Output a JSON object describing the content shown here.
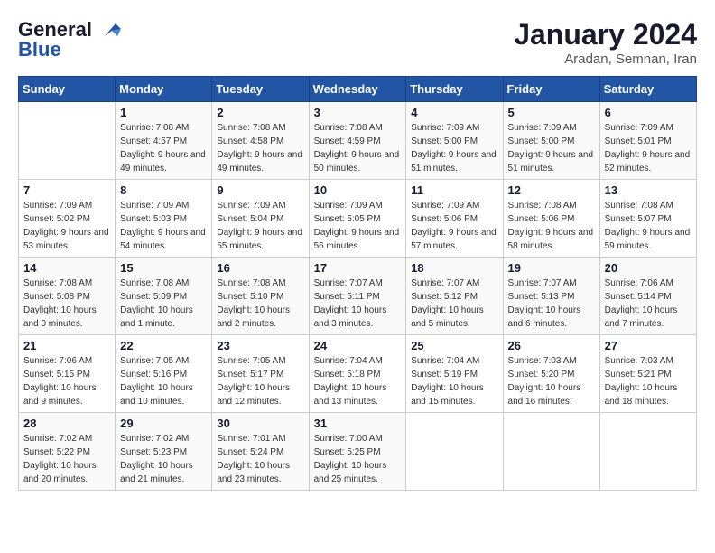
{
  "logo": {
    "line1": "General",
    "line2": "Blue"
  },
  "calendar": {
    "title": "January 2024",
    "subtitle": "Aradan, Semnan, Iran"
  },
  "headers": [
    "Sunday",
    "Monday",
    "Tuesday",
    "Wednesday",
    "Thursday",
    "Friday",
    "Saturday"
  ],
  "weeks": [
    [
      {
        "day": "",
        "sunrise": "",
        "sunset": "",
        "daylight": ""
      },
      {
        "day": "1",
        "sunrise": "Sunrise: 7:08 AM",
        "sunset": "Sunset: 4:57 PM",
        "daylight": "Daylight: 9 hours and 49 minutes."
      },
      {
        "day": "2",
        "sunrise": "Sunrise: 7:08 AM",
        "sunset": "Sunset: 4:58 PM",
        "daylight": "Daylight: 9 hours and 49 minutes."
      },
      {
        "day": "3",
        "sunrise": "Sunrise: 7:08 AM",
        "sunset": "Sunset: 4:59 PM",
        "daylight": "Daylight: 9 hours and 50 minutes."
      },
      {
        "day": "4",
        "sunrise": "Sunrise: 7:09 AM",
        "sunset": "Sunset: 5:00 PM",
        "daylight": "Daylight: 9 hours and 51 minutes."
      },
      {
        "day": "5",
        "sunrise": "Sunrise: 7:09 AM",
        "sunset": "Sunset: 5:00 PM",
        "daylight": "Daylight: 9 hours and 51 minutes."
      },
      {
        "day": "6",
        "sunrise": "Sunrise: 7:09 AM",
        "sunset": "Sunset: 5:01 PM",
        "daylight": "Daylight: 9 hours and 52 minutes."
      }
    ],
    [
      {
        "day": "7",
        "sunrise": "Sunrise: 7:09 AM",
        "sunset": "Sunset: 5:02 PM",
        "daylight": "Daylight: 9 hours and 53 minutes."
      },
      {
        "day": "8",
        "sunrise": "Sunrise: 7:09 AM",
        "sunset": "Sunset: 5:03 PM",
        "daylight": "Daylight: 9 hours and 54 minutes."
      },
      {
        "day": "9",
        "sunrise": "Sunrise: 7:09 AM",
        "sunset": "Sunset: 5:04 PM",
        "daylight": "Daylight: 9 hours and 55 minutes."
      },
      {
        "day": "10",
        "sunrise": "Sunrise: 7:09 AM",
        "sunset": "Sunset: 5:05 PM",
        "daylight": "Daylight: 9 hours and 56 minutes."
      },
      {
        "day": "11",
        "sunrise": "Sunrise: 7:09 AM",
        "sunset": "Sunset: 5:06 PM",
        "daylight": "Daylight: 9 hours and 57 minutes."
      },
      {
        "day": "12",
        "sunrise": "Sunrise: 7:08 AM",
        "sunset": "Sunset: 5:06 PM",
        "daylight": "Daylight: 9 hours and 58 minutes."
      },
      {
        "day": "13",
        "sunrise": "Sunrise: 7:08 AM",
        "sunset": "Sunset: 5:07 PM",
        "daylight": "Daylight: 9 hours and 59 minutes."
      }
    ],
    [
      {
        "day": "14",
        "sunrise": "Sunrise: 7:08 AM",
        "sunset": "Sunset: 5:08 PM",
        "daylight": "Daylight: 10 hours and 0 minutes."
      },
      {
        "day": "15",
        "sunrise": "Sunrise: 7:08 AM",
        "sunset": "Sunset: 5:09 PM",
        "daylight": "Daylight: 10 hours and 1 minute."
      },
      {
        "day": "16",
        "sunrise": "Sunrise: 7:08 AM",
        "sunset": "Sunset: 5:10 PM",
        "daylight": "Daylight: 10 hours and 2 minutes."
      },
      {
        "day": "17",
        "sunrise": "Sunrise: 7:07 AM",
        "sunset": "Sunset: 5:11 PM",
        "daylight": "Daylight: 10 hours and 3 minutes."
      },
      {
        "day": "18",
        "sunrise": "Sunrise: 7:07 AM",
        "sunset": "Sunset: 5:12 PM",
        "daylight": "Daylight: 10 hours and 5 minutes."
      },
      {
        "day": "19",
        "sunrise": "Sunrise: 7:07 AM",
        "sunset": "Sunset: 5:13 PM",
        "daylight": "Daylight: 10 hours and 6 minutes."
      },
      {
        "day": "20",
        "sunrise": "Sunrise: 7:06 AM",
        "sunset": "Sunset: 5:14 PM",
        "daylight": "Daylight: 10 hours and 7 minutes."
      }
    ],
    [
      {
        "day": "21",
        "sunrise": "Sunrise: 7:06 AM",
        "sunset": "Sunset: 5:15 PM",
        "daylight": "Daylight: 10 hours and 9 minutes."
      },
      {
        "day": "22",
        "sunrise": "Sunrise: 7:05 AM",
        "sunset": "Sunset: 5:16 PM",
        "daylight": "Daylight: 10 hours and 10 minutes."
      },
      {
        "day": "23",
        "sunrise": "Sunrise: 7:05 AM",
        "sunset": "Sunset: 5:17 PM",
        "daylight": "Daylight: 10 hours and 12 minutes."
      },
      {
        "day": "24",
        "sunrise": "Sunrise: 7:04 AM",
        "sunset": "Sunset: 5:18 PM",
        "daylight": "Daylight: 10 hours and 13 minutes."
      },
      {
        "day": "25",
        "sunrise": "Sunrise: 7:04 AM",
        "sunset": "Sunset: 5:19 PM",
        "daylight": "Daylight: 10 hours and 15 minutes."
      },
      {
        "day": "26",
        "sunrise": "Sunrise: 7:03 AM",
        "sunset": "Sunset: 5:20 PM",
        "daylight": "Daylight: 10 hours and 16 minutes."
      },
      {
        "day": "27",
        "sunrise": "Sunrise: 7:03 AM",
        "sunset": "Sunset: 5:21 PM",
        "daylight": "Daylight: 10 hours and 18 minutes."
      }
    ],
    [
      {
        "day": "28",
        "sunrise": "Sunrise: 7:02 AM",
        "sunset": "Sunset: 5:22 PM",
        "daylight": "Daylight: 10 hours and 20 minutes."
      },
      {
        "day": "29",
        "sunrise": "Sunrise: 7:02 AM",
        "sunset": "Sunset: 5:23 PM",
        "daylight": "Daylight: 10 hours and 21 minutes."
      },
      {
        "day": "30",
        "sunrise": "Sunrise: 7:01 AM",
        "sunset": "Sunset: 5:24 PM",
        "daylight": "Daylight: 10 hours and 23 minutes."
      },
      {
        "day": "31",
        "sunrise": "Sunrise: 7:00 AM",
        "sunset": "Sunset: 5:25 PM",
        "daylight": "Daylight: 10 hours and 25 minutes."
      },
      {
        "day": "",
        "sunrise": "",
        "sunset": "",
        "daylight": ""
      },
      {
        "day": "",
        "sunrise": "",
        "sunset": "",
        "daylight": ""
      },
      {
        "day": "",
        "sunrise": "",
        "sunset": "",
        "daylight": ""
      }
    ]
  ]
}
